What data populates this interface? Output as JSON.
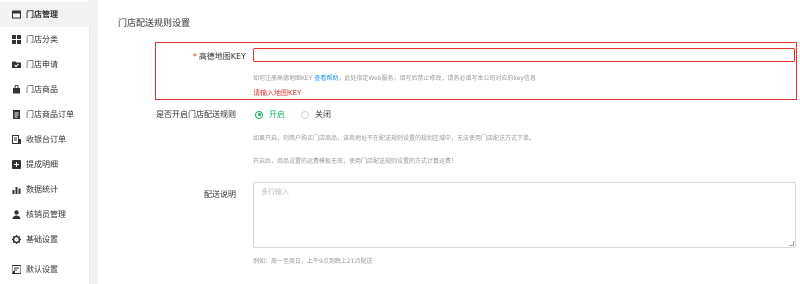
{
  "sidebar": {
    "items": [
      {
        "label": "门店管理",
        "icon": "store-icon"
      },
      {
        "label": "门店分类",
        "icon": "category-grid-icon"
      },
      {
        "label": "门店申请",
        "icon": "folder-check-icon"
      },
      {
        "label": "门店商品",
        "icon": "bag-icon"
      },
      {
        "label": "门店商品订单",
        "icon": "document-icon"
      },
      {
        "label": "收银台订单",
        "icon": "cashier-icon"
      },
      {
        "label": "提成明细",
        "icon": "plus-box-icon"
      },
      {
        "label": "数据统计",
        "icon": "bar-chart-icon"
      },
      {
        "label": "核销员管理",
        "icon": "user-icon"
      },
      {
        "label": "基础设置",
        "icon": "gear-icon"
      },
      {
        "label": "默认设置",
        "icon": "settings-list-icon"
      }
    ]
  },
  "main": {
    "title": "门店配送规则设置",
    "amap_key": {
      "required_mark": "*",
      "label": "高德地图KEY",
      "value": "",
      "help_prefix": "如何注册高德地图KEY",
      "help_link": "查看帮助",
      "help_suffix": "，此处指定Web服务，填写后禁止修改，请务必填写本公司对应的key信息",
      "error": "请输入地图KEY"
    },
    "delivery_toggle": {
      "label": "是否开启门店配送规则",
      "options": [
        "开启",
        "关闭"
      ],
      "selected": "开启",
      "note1": "如果开启，则用户购买门店商品，该商地址不在配送规则设置的规划区域中，无法使用门店配送方式下单。",
      "note2": "开启后，商品设置的运费模板无效，使用门店配送规则设置的方式计算运费！"
    },
    "delivery_desc": {
      "label": "配送说明",
      "placeholder": "多行输入",
      "example": "例如：周一至周日，上午9点到晚上21点配送"
    }
  },
  "colors": {
    "accent": "#18b566",
    "error": "#e0332e",
    "link": "#1890ff"
  }
}
